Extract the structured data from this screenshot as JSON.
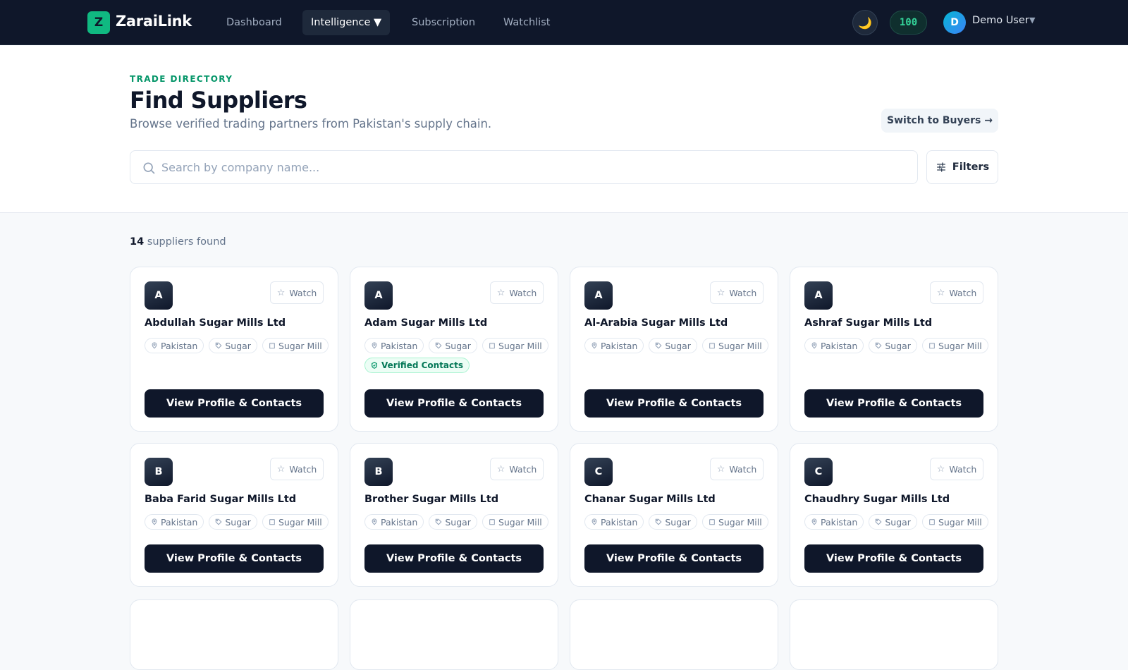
{
  "nav": {
    "logo_letter": "Z",
    "brand": "ZaraiLink",
    "links": [
      {
        "label": "Dashboard"
      },
      {
        "label": "Intelligence ▼"
      },
      {
        "label": "Subscription"
      },
      {
        "label": "Watchlist"
      }
    ],
    "theme_icon": "🌙",
    "credits": "100",
    "user_initial": "D",
    "user_name": "Demo User",
    "user_caret": "▼"
  },
  "header": {
    "eyebrow": "TRADE DIRECTORY",
    "title": "Find Suppliers",
    "subtitle": "Browse verified trading partners from Pakistan's supply chain.",
    "switch_label": "Switch to Buyers →",
    "search_placeholder": "Search by company name...",
    "search_value": "",
    "filters_label": "Filters"
  },
  "results": {
    "count": "14",
    "count_suffix": " suppliers found"
  },
  "card_labels": {
    "watch": "Watch",
    "view": "View Profile & Contacts",
    "verified": "Verified Contacts"
  },
  "cards": [
    {
      "initial": "A",
      "name": "Abdullah Sugar Mills Ltd",
      "location": "Pakistan",
      "product": "Sugar",
      "type": "Sugar Mill"
    },
    {
      "initial": "A",
      "name": "Adam Sugar Mills Ltd",
      "location": "Pakistan",
      "product": "Sugar",
      "type": "Sugar Mill",
      "verified": true
    },
    {
      "initial": "A",
      "name": "Al-Arabia Sugar Mills Ltd",
      "location": "Pakistan",
      "product": "Sugar",
      "type": "Sugar Mill"
    },
    {
      "initial": "A",
      "name": "Ashraf Sugar Mills Ltd",
      "location": "Pakistan",
      "product": "Sugar",
      "type": "Sugar Mill"
    },
    {
      "initial": "B",
      "name": "Baba Farid Sugar Mills Ltd",
      "location": "Pakistan",
      "product": "Sugar",
      "type": "Sugar Mill"
    },
    {
      "initial": "B",
      "name": "Brother Sugar Mills Ltd",
      "location": "Pakistan",
      "product": "Sugar",
      "type": "Sugar Mill"
    },
    {
      "initial": "C",
      "name": "Chanar Sugar Mills Ltd",
      "location": "Pakistan",
      "product": "Sugar",
      "type": "Sugar Mill"
    },
    {
      "initial": "C",
      "name": "Chaudhry Sugar Mills Ltd",
      "location": "Pakistan",
      "product": "Sugar",
      "type": "Sugar Mill"
    }
  ],
  "colors": {
    "nav_bg": "#0f172a",
    "accent": "#10b981",
    "button_dark": "#0f172a",
    "page_bg": "#f7f9fb"
  }
}
